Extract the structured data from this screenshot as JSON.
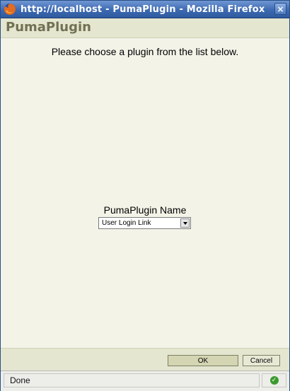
{
  "window": {
    "title": "http://localhost - PumaPlugin - Mozilla Firefox",
    "close_glyph": "×"
  },
  "header": {
    "title": "PumaPlugin"
  },
  "main": {
    "instruction": "Please choose a plugin from the list below.",
    "field_label": "PumaPlugin Name",
    "plugin_select": {
      "selected": "User Login Link"
    }
  },
  "footer": {
    "ok_label": "OK",
    "cancel_label": "Cancel"
  },
  "statusbar": {
    "text": "Done",
    "icon": "secure-check-icon"
  },
  "colors": {
    "titlebar": "#3d69b1",
    "header_bg": "#e5e6d0",
    "header_text": "#707153",
    "body_bg": "#f3f3e8",
    "status_ok": "#3c9a2f"
  }
}
